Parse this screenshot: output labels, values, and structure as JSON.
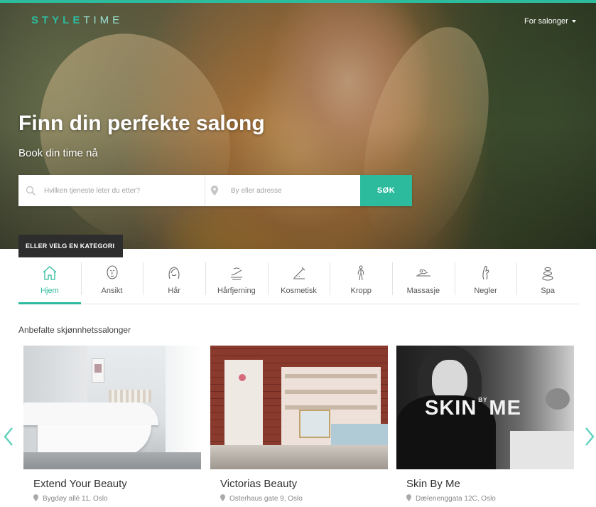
{
  "brand": {
    "logo_part1": "STYLE",
    "logo_part2": "TIME",
    "accent_color": "#2dbb9e"
  },
  "header": {
    "salons_link": "For salonger"
  },
  "hero": {
    "title": "Finn din perfekte salong",
    "subtitle": "Book din time nå",
    "search": {
      "service_placeholder": "Hvilken tjeneste leter du etter?",
      "location_placeholder": "By eller adresse",
      "button_label": "SØK"
    },
    "category_tab": "ELLER VELG EN KATEGORI"
  },
  "categories": [
    {
      "label": "Hjem",
      "icon": "home-icon",
      "active": true
    },
    {
      "label": "Ansikt",
      "icon": "face-icon",
      "active": false
    },
    {
      "label": "Hår",
      "icon": "hair-icon",
      "active": false
    },
    {
      "label": "Hårfjerning",
      "icon": "hair-removal-icon",
      "active": false
    },
    {
      "label": "Kosmetisk",
      "icon": "cosmetic-icon",
      "active": false
    },
    {
      "label": "Kropp",
      "icon": "body-icon",
      "active": false
    },
    {
      "label": "Massasje",
      "icon": "massage-icon",
      "active": false
    },
    {
      "label": "Negler",
      "icon": "nails-icon",
      "active": false
    },
    {
      "label": "Spa",
      "icon": "spa-stones-icon",
      "active": false
    }
  ],
  "recommended": {
    "title": "Anbefalte skjønnhetssalonger",
    "salons": [
      {
        "name": "Extend Your Beauty",
        "address": "Bygdøy allé 11, Oslo"
      },
      {
        "name": "Victorias Beauty",
        "address": "Osterhaus gate 9, Oslo"
      },
      {
        "name": "Skin By Me",
        "address": "Dælenenggata 12C, Oslo",
        "image_text": "SKIN",
        "image_text2": "ME",
        "image_text_small": "BY"
      }
    ]
  }
}
